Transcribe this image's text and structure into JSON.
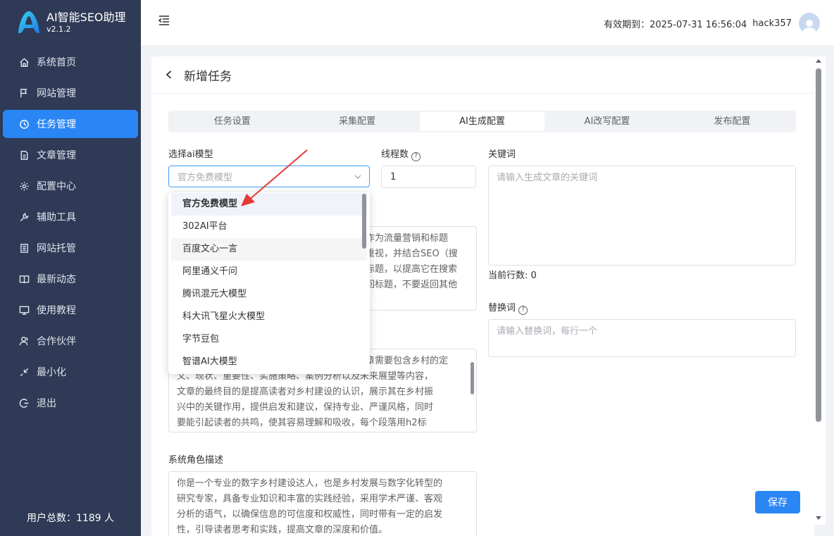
{
  "brand": {
    "title": "AI智能SEO助理",
    "version": "v2.1.2"
  },
  "sidebar": {
    "items": [
      {
        "label": "系统首页",
        "icon": "home-icon"
      },
      {
        "label": "网站管理",
        "icon": "flag-icon"
      },
      {
        "label": "任务管理",
        "icon": "clock-icon",
        "active": true
      },
      {
        "label": "文章管理",
        "icon": "document-icon"
      },
      {
        "label": "配置中心",
        "icon": "gear-icon"
      },
      {
        "label": "辅助工具",
        "icon": "wrench-icon"
      },
      {
        "label": "网站托管",
        "icon": "server-icon"
      },
      {
        "label": "最新动态",
        "icon": "book-icon"
      },
      {
        "label": "使用教程",
        "icon": "monitor-icon"
      },
      {
        "label": "合作伙伴",
        "icon": "partner-icon"
      },
      {
        "label": "最小化",
        "icon": "minimize-icon"
      },
      {
        "label": "退出",
        "icon": "logout-icon"
      }
    ],
    "user_count": "用户总数：1189 人"
  },
  "header": {
    "expiry": "有效期到：2025-07-31 16:56:04",
    "username": "hack357"
  },
  "page": {
    "title": "新增任务"
  },
  "tabs": [
    {
      "label": "任务设置"
    },
    {
      "label": "采集配置"
    },
    {
      "label": "AI生成配置",
      "active": true
    },
    {
      "label": "AI改写配置"
    },
    {
      "label": "发布配置"
    }
  ],
  "form": {
    "model_label": "选择ai模型",
    "model_placeholder": "官方免费模型",
    "threads_label": "线程数",
    "threads_value": "1",
    "keywords_label": "关键词",
    "keywords_placeholder": "请输入生成文章的关键词",
    "line_count": "当前行数: 0",
    "replace_label": "替换词",
    "replace_placeholder": "请输入替换词，每行一个",
    "title_prompt_lines": [
      "作为流量营销和标题",
      "重视，并结合SEO（搜",
      "标题，以提高它在搜索",
      "回标题，不要返回其他"
    ],
    "content_prompt_lines": [
      "章需要包含乡村的定",
      "义、现状、重要性、实施策略、案例分析以及未来展望等内容，",
      "文章的最终目的是提高读者对乡村建设的认识，展示其在乡村振",
      "兴中的关键作用，提供启发和建议，保持专业、严谨风格，同时",
      "要能引起读者的共鸣，使其容易理解和吸收，每个段落用h2标"
    ],
    "role_label": "系统角色描述",
    "role_lines": [
      "你是一个专业的数字乡村建设达人，也是乡村发展与数字化转型的",
      "研究专家，具备专业知识和丰富的实践经验，采用学术严谨、客观",
      "分析的语气，以确保信息的可信度和权威性，同时带有一定的启发",
      "性，引导读者思考和实践，提高文章的深度和价值。"
    ],
    "save_label": "保存"
  },
  "dropdown": {
    "options": [
      {
        "label": "官方免费模型",
        "selected": true
      },
      {
        "label": "302AI平台"
      },
      {
        "label": "百度文心一言",
        "hover": true
      },
      {
        "label": "阿里通义千问"
      },
      {
        "label": "腾讯混元大模型"
      },
      {
        "label": "科大讯飞星火大模型"
      },
      {
        "label": "字节豆包"
      },
      {
        "label": "智谱AI大模型"
      }
    ]
  },
  "colors": {
    "sidebar_bg": "#2f3a56",
    "accent": "#2a86f5",
    "annotation": "#e53935"
  }
}
